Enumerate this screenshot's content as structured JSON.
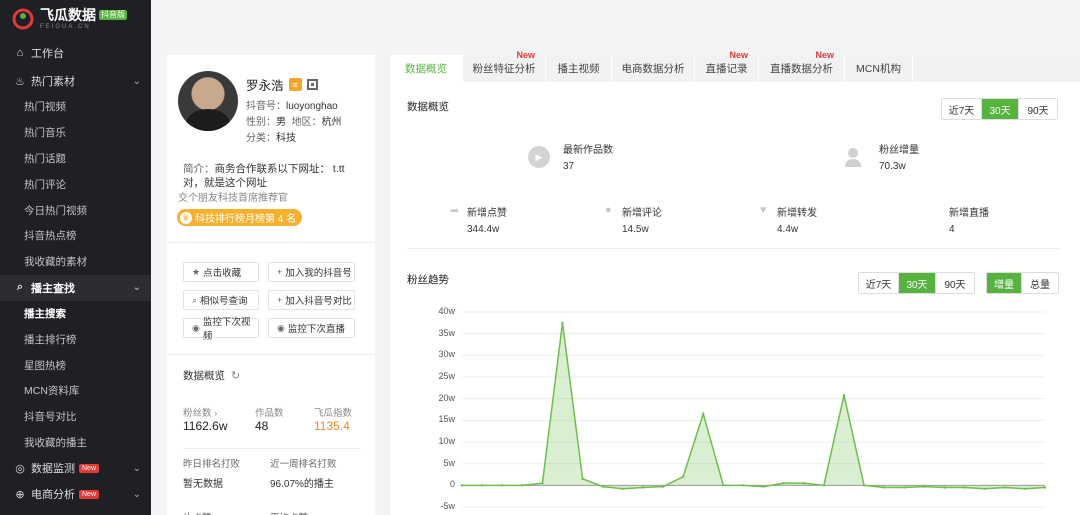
{
  "app": {
    "logo_title": "飞瓜数据",
    "logo_badge": "抖音版",
    "logo_sub": "FEIGUA.CN"
  },
  "sidebar": {
    "sections": [
      {
        "label": "工作台",
        "icon": "home-icon",
        "type": "top"
      },
      {
        "label": "热门素材",
        "icon": "fire-icon",
        "expanded": true,
        "items": [
          "热门视频",
          "热门音乐",
          "热门话题",
          "热门评论",
          "今日热门视频",
          "抖音热点榜",
          "我收藏的素材"
        ]
      },
      {
        "label": "播主查找",
        "icon": "search-icon",
        "expanded": true,
        "active": true,
        "items": [
          "播主搜索",
          "播主排行榜",
          "星图热榜",
          "MCN资料库",
          "抖音号对比",
          "我收藏的播主"
        ],
        "active_item": 0
      },
      {
        "label": "数据监测",
        "icon": "monitor-icon",
        "badge": "New"
      },
      {
        "label": "电商分析",
        "icon": "cart-icon",
        "badge": "New"
      }
    ]
  },
  "profile": {
    "name": "罗永浩",
    "douyin_id_label": "抖音号：",
    "douyin_id": "luoyonghao",
    "gender_label": "性别：",
    "gender": "男",
    "region_label": "地区：",
    "region": "杭州",
    "category_label": "分类：",
    "category": "科技",
    "intro_label": "简介：",
    "intro": "商务合作联系以下网址： t.tt 对，就是这个网址",
    "intro2": "交个朋友科技首席推荐官",
    "rank": "科技排行榜月榜第 4 名",
    "actions": [
      {
        "label": "点击收藏",
        "icon": "star-icon",
        "glyph": "★"
      },
      {
        "label": "加入我的抖音号",
        "icon": "plus-icon",
        "glyph": "+"
      },
      {
        "label": "相似号查询",
        "icon": "search-icon",
        "glyph": "⌕"
      },
      {
        "label": "加入抖音号对比",
        "icon": "plus-icon",
        "glyph": "+"
      },
      {
        "label": "监控下次视频",
        "icon": "eye-icon",
        "glyph": "◉"
      },
      {
        "label": "监控下次直播",
        "icon": "eye-icon",
        "glyph": "◉"
      }
    ],
    "overview_title": "数据概览",
    "stats": [
      {
        "label": "粉丝数 ›",
        "value": "1162.6w"
      },
      {
        "label": "作品数",
        "value": "48"
      },
      {
        "label": "飞瓜指数",
        "value": "1135.4",
        "color": "#f08a24"
      }
    ],
    "stats2": [
      {
        "label": "昨日排名打败",
        "value": "暂无数据"
      },
      {
        "label": "近一周排名打败",
        "value": "96.07%的播主"
      }
    ],
    "more_labels": [
      "片点赞",
      "平均点赞"
    ]
  },
  "main": {
    "tabs": [
      {
        "label": "数据概览",
        "active": true
      },
      {
        "label": "粉丝特征分析",
        "new": "New"
      },
      {
        "label": "播主视频"
      },
      {
        "label": "电商数据分析"
      },
      {
        "label": "直播记录",
        "new": "New"
      },
      {
        "label": "直播数据分析",
        "new": "New"
      },
      {
        "label": "MCN机构"
      }
    ],
    "overview": {
      "title": "数据概览",
      "ranges": [
        "近7天",
        "30天",
        "90天"
      ],
      "active_range": 1,
      "kpis_top": [
        {
          "label": "最新作品数",
          "value": "37",
          "icon": "play-icon"
        },
        {
          "label": "粉丝增量",
          "value": "70.3w",
          "icon": "user-icon"
        }
      ],
      "kpis_bottom": [
        {
          "label": "新增点赞",
          "value": "344.4w",
          "icon": "share-icon"
        },
        {
          "label": "新增评论",
          "value": "14.5w",
          "icon": "comment-icon"
        },
        {
          "label": "新增转发",
          "value": "4.4w",
          "icon": "heart-icon"
        },
        {
          "label": "新增直播",
          "value": "4",
          "icon": ""
        }
      ]
    },
    "trend": {
      "title": "粉丝趋势",
      "ranges": [
        "近7天",
        "30天",
        "90天"
      ],
      "active_range": 1,
      "modes": [
        "增量",
        "总量"
      ],
      "active_mode": 0
    }
  },
  "chart_data": {
    "type": "area",
    "title": "粉丝趋势",
    "ylim": [
      -5,
      40
    ],
    "yticks": [
      "40w",
      "35w",
      "30w",
      "25w",
      "20w",
      "15w",
      "10w",
      "5w",
      "0",
      "-5w"
    ],
    "ytick_values": [
      40,
      35,
      30,
      25,
      20,
      15,
      10,
      5,
      0,
      -5
    ],
    "grid": true,
    "color": "#6cc04a",
    "series": [
      {
        "values": [
          0,
          0,
          0,
          0,
          0.5,
          37.5,
          1.5,
          -0.3,
          -0.8,
          -0.5,
          -0.3,
          2,
          16.5,
          0,
          0,
          -0.3,
          0.5,
          0.5,
          0,
          20.8,
          0,
          -0.5,
          -0.5,
          -0.3,
          -0.5,
          -0.5,
          -0.8,
          -0.5,
          -0.8,
          -0.5
        ]
      }
    ]
  }
}
